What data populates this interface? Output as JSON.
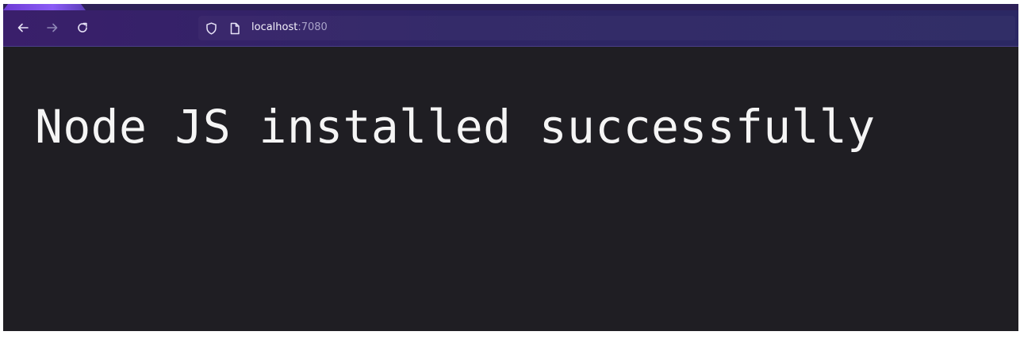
{
  "browser": {
    "url": {
      "host": "localhost",
      "port": ":7080"
    },
    "icons": {
      "back": "back-arrow-icon",
      "forward": "forward-arrow-icon",
      "reload": "reload-icon",
      "tracking_protection": "shield-icon",
      "page_info": "page-icon"
    },
    "colors": {
      "toolbar": "#2e2565",
      "accent": "#8b5cf6",
      "page_background": "#1f1e23",
      "text": "#f5f5f5"
    }
  },
  "page": {
    "heading": "Node JS installed successfully"
  }
}
